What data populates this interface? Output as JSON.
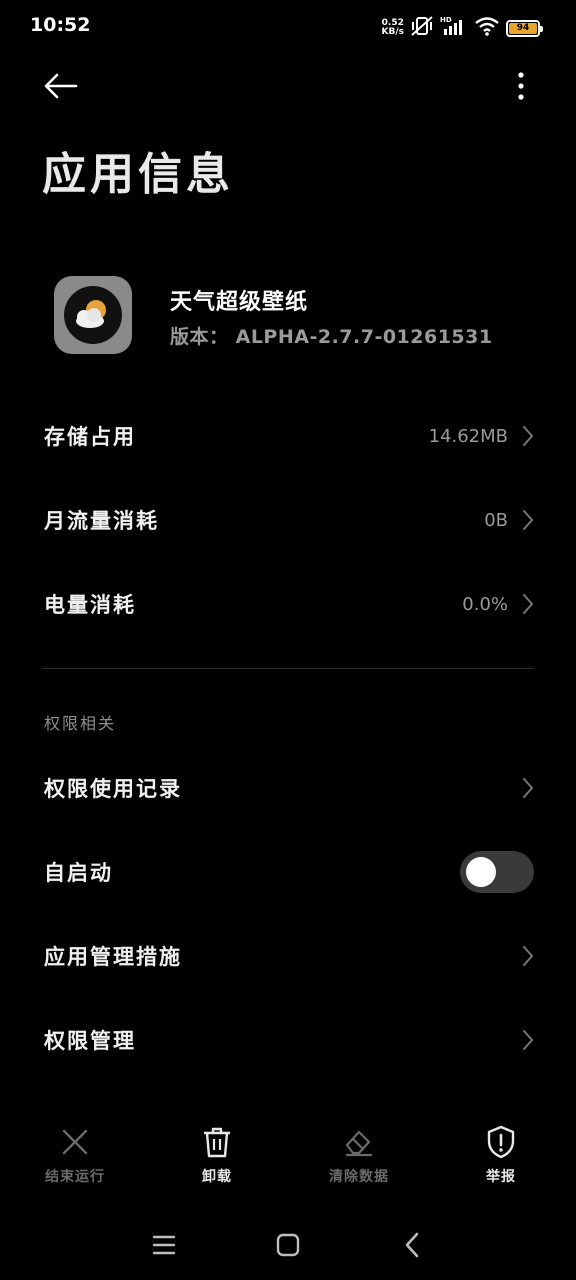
{
  "status_bar": {
    "time": "10:52",
    "net_speed_value": "0.52",
    "net_speed_unit": "KB/s",
    "battery_level": "94",
    "icons": [
      "mute-vibrate-icon",
      "hd-signal-icon",
      "wifi-icon",
      "battery-icon"
    ]
  },
  "page": {
    "title": "应用信息"
  },
  "app": {
    "name": "天气超级壁纸",
    "version": "版本： ALPHA-2.7.7-01261531",
    "icon": "weather-cloud-sun-icon"
  },
  "usage_rows": [
    {
      "label": "存储占用",
      "value": "14.62MB"
    },
    {
      "label": "月流量消耗",
      "value": "0B"
    },
    {
      "label": "电量消耗",
      "value": "0.0%"
    }
  ],
  "permissions": {
    "section_title": "权限相关",
    "rows": [
      {
        "label": "权限使用记录"
      },
      {
        "label": "自启动",
        "toggle": false
      },
      {
        "label": "应用管理措施"
      },
      {
        "label": "权限管理"
      }
    ]
  },
  "actions": [
    {
      "label": "结束运行",
      "icon": "close-x-icon",
      "enabled": false
    },
    {
      "label": "卸载",
      "icon": "trash-icon",
      "enabled": true
    },
    {
      "label": "清除数据",
      "icon": "eraser-icon",
      "enabled": false
    },
    {
      "label": "举报",
      "icon": "shield-alert-icon",
      "enabled": true
    }
  ],
  "nav_bar": {
    "icons": [
      "menu-icon",
      "home-icon",
      "back-nav-icon"
    ]
  },
  "colors": {
    "background": "#000000",
    "battery": "#e6a52a",
    "secondary_text": "#9a9a9a"
  }
}
